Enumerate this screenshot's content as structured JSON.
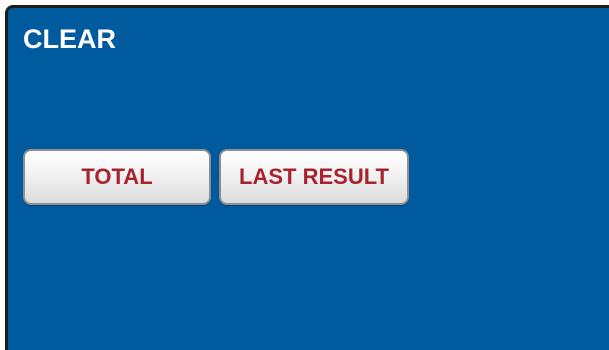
{
  "panel": {
    "title": "CLEAR"
  },
  "buttons": {
    "total_label": "TOTAL",
    "last_result_label": "LAST RESULT"
  },
  "colors": {
    "panel_background": "#005a9e",
    "title_text": "#ffffff",
    "button_text": "#a8232f"
  }
}
